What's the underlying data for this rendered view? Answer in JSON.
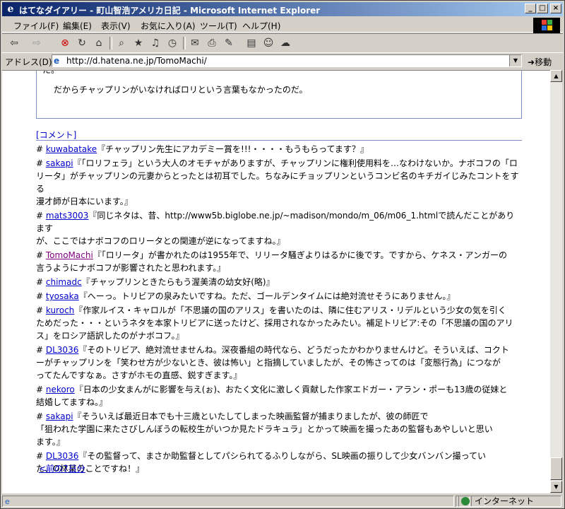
{
  "window": {
    "title": "はてなダイアリー - 町山智浩アメリカ日記 - Microsoft Internet Explorer",
    "minimize": "_",
    "maximize": "□",
    "close": "×"
  },
  "menu": [
    "ファイル(F)",
    "編集(E)",
    "表示(V)",
    "お気に入り(A)",
    "ツール(T)",
    "ヘルプ(H)"
  ],
  "address": {
    "label": "アドレス(D)",
    "url": "http://d.hatena.ne.jp/TomoMachi/",
    "go": "移動"
  },
  "article": {
    "line_top": "た。",
    "line_main": "だからチャップリンがいなければロリという言葉もなかったのだ。"
  },
  "comment_link": "[コメント]",
  "comments": [
    {
      "user": "kuwabatake",
      "lines": [
        "『チャップリン先生にアカデミー賞を!!!・・・・もうもらってます？』"
      ]
    },
    {
      "user": "sakapi",
      "lines": [
        "『「ロリフェラ」という大人のオモチャがありますが、チャップリンに権利使用料を…なわけないか。ナボコフの「ロ",
        "リータ」がチャップリンの元妻からとったとは初耳でした。ちなみにチョップリンというコンビ名のキチガイじみたコントをする",
        "漫才師が日本にいます。』"
      ]
    },
    {
      "user": "mats3003",
      "lines": [
        "『同じネタは、昔、http://www5b.biglobe.ne.jp/~madison/mondo/m_06/m06_1.htmlで読んだことがあります",
        "が、ここではナボコフのロリータとの関連が逆になってますね。』"
      ]
    },
    {
      "user": "TomoMachi",
      "lines": [
        "『「ロリータ」が書かれたのは1955年で、リリータ騒ぎよりはるかに後です。ですから、ケネス・アンガーの",
        "言うようにナボコフが影響されたと思われます。』"
      ],
      "visited": true
    },
    {
      "user": "chimadc",
      "lines": [
        "『チャップリンときたらもう渥美清の幼女好(略)』"
      ]
    },
    {
      "user": "tyosaka",
      "lines": [
        "『へーっ。トリビアの泉みたいですね。ただ、ゴールデンタイムには絶対流せそうにありません。』"
      ]
    },
    {
      "user": "kuroch",
      "lines": [
        "『作家ルイス・キャロルが「不思議の国のアリス」を書いたのは、隣に住むアリス・リデルという少女の気を引く",
        "ためだった・・・というネタを本家トリビアに送ったけど、採用されなかったみたい。補足トリビア:その「不思議の国のアリ",
        "ス」をロシア語訳したのがナボコフ。』"
      ]
    },
    {
      "user": "DL3036",
      "lines": [
        "『そのトリビア、絶対流せませんね。深夜番組の時代なら、どうだったかわかりませんけど。そういえば、コクト",
        "ーがチャップリンを「笑わせ方が少ないとき、彼は怖い」と指摘していましたが、その怖さってのは「変態行為」につなが",
        "ってたんですなぁ。さすがホモの直感、鋭すぎます。』"
      ]
    },
    {
      "user": "nekoro",
      "lines": [
        "『日本の少女まんがに影響を与え(ぉ)、おたく文化に激しく貢献した作家エドガー・アラン・ポーも13歳の従妹と",
        "結婚してますね。』"
      ]
    },
    {
      "user": "sakapi",
      "lines": [
        "『そういえば最近日本でも十三歳といたしてしまった映画監督が捕まりましたが、彼の師匠で",
        "「狙われた学園に来たさびしんぼうの転校生がいつか見たドラキュラ」とかって映画を撮ったあの監督もあやしいと思い",
        "ます。』"
      ]
    },
    {
      "user": "DL3036",
      "lines": [
        "『その監督って、まさか助監督としてパシられてるふりしながら、SL映画の振りして少女バンバン撮ってい",
        "た、O林某のことですね！』"
      ]
    }
  ],
  "prev_link": "<前の7日分",
  "status": {
    "zone": "インターネット"
  }
}
